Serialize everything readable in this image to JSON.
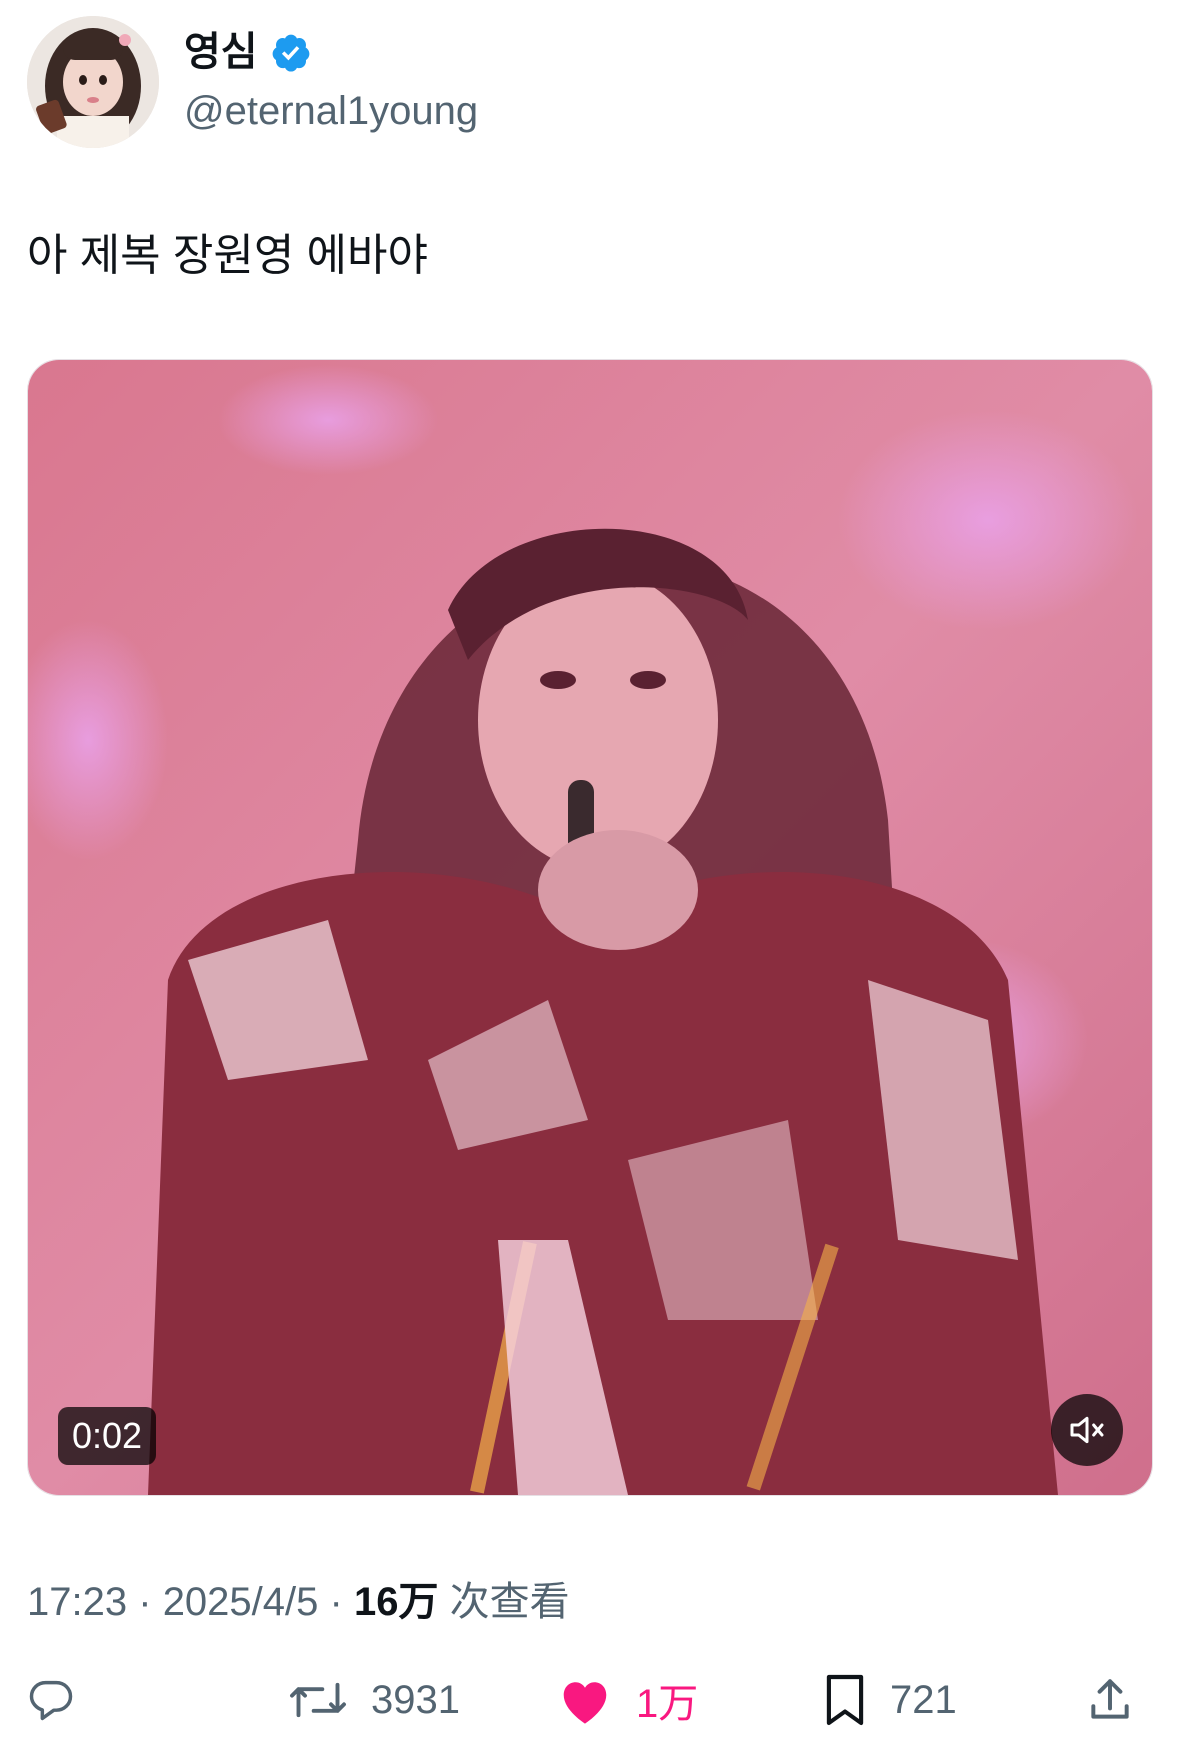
{
  "user": {
    "display_name": "영심",
    "handle": "@eternal1young",
    "verified": true
  },
  "tweet": {
    "text": "아 제복 장원영 에바야"
  },
  "media": {
    "type": "video",
    "duration": "0:02",
    "muted": true
  },
  "meta": {
    "time": "17:23",
    "separator": "·",
    "date": "2025/4/5",
    "views_count": "16万",
    "views_label": "次查看"
  },
  "actions": {
    "reply": {
      "icon": "reply-icon",
      "count": ""
    },
    "retweet": {
      "icon": "retweet-icon",
      "count": "3931"
    },
    "like": {
      "icon": "heart-icon",
      "count": "1万",
      "active": true
    },
    "bookmark": {
      "icon": "bookmark-icon",
      "count": "721"
    },
    "share": {
      "icon": "share-icon"
    }
  },
  "colors": {
    "verified": "#1d9bf0",
    "like_active": "#f91880",
    "secondary_text": "#536471",
    "primary_text": "#0f1419"
  }
}
